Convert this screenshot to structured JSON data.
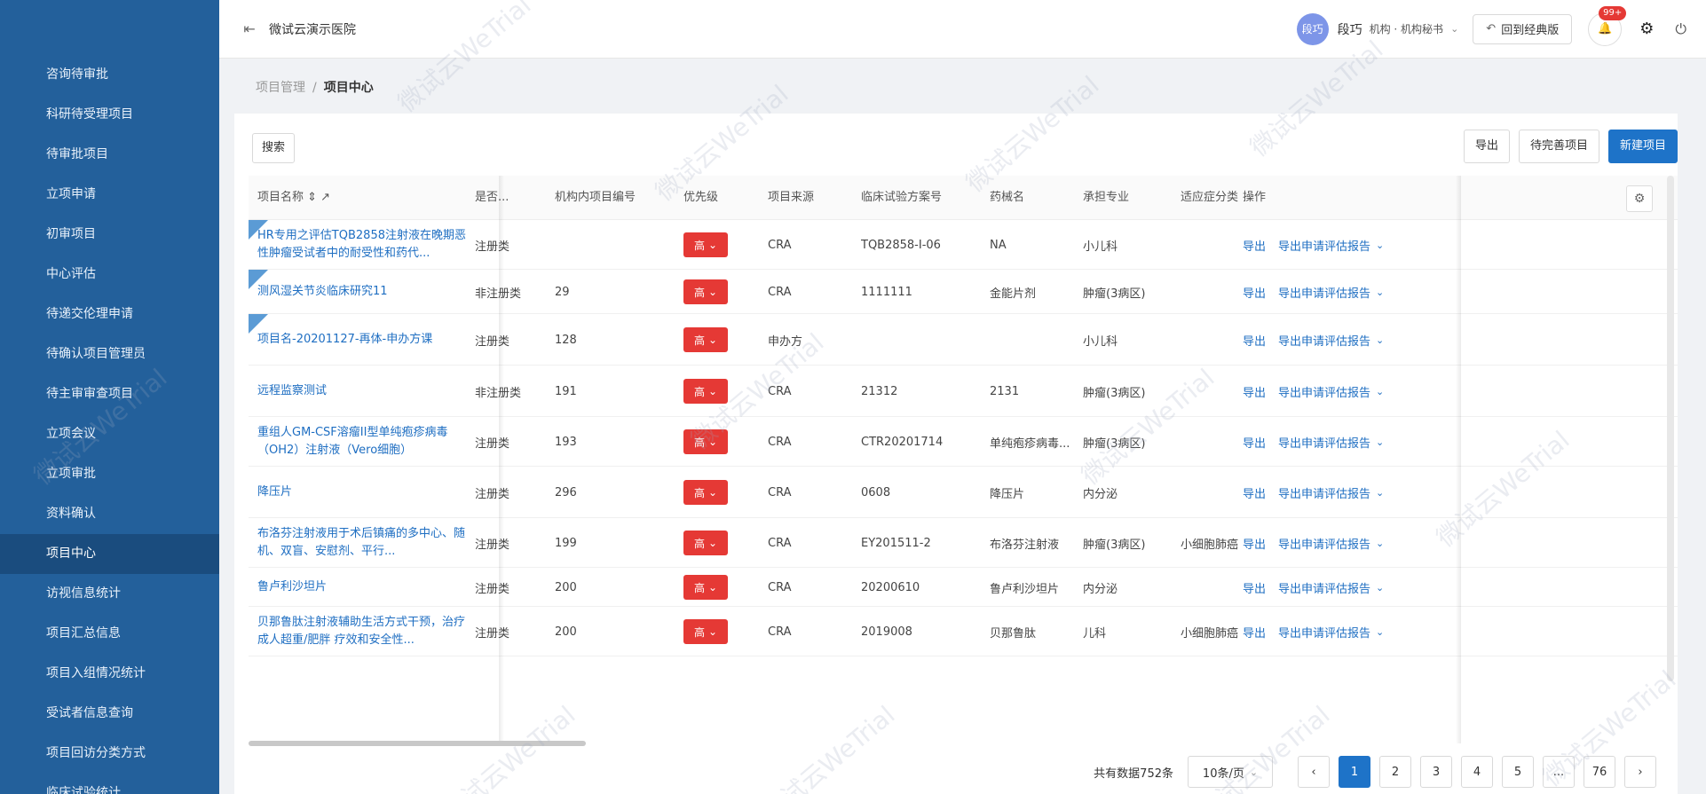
{
  "header": {
    "hospital_name": "微试云演示医院",
    "avatar_text": "段巧",
    "user_name": "段巧",
    "user_role": "机构 · 机构秘书",
    "classic_label": "回到经典版",
    "badge": "99+"
  },
  "sidebar": {
    "items": [
      {
        "label": "咨询待审批"
      },
      {
        "label": "科研待受理项目"
      },
      {
        "label": "待审批项目"
      },
      {
        "label": "立项申请"
      },
      {
        "label": "初审项目"
      },
      {
        "label": "中心评估"
      },
      {
        "label": "待递交伦理申请"
      },
      {
        "label": "待确认项目管理员"
      },
      {
        "label": "待主审审查项目"
      },
      {
        "label": "立项会议"
      },
      {
        "label": "立项审批"
      },
      {
        "label": "资料确认"
      },
      {
        "label": "项目中心"
      },
      {
        "label": "访视信息统计"
      },
      {
        "label": "项目汇总信息"
      },
      {
        "label": "项目入组情况统计"
      },
      {
        "label": "受试者信息查询"
      },
      {
        "label": "项目回访分类方式"
      },
      {
        "label": "临床试验统计"
      }
    ],
    "active_index": 12
  },
  "breadcrumb": {
    "parent": "项目管理",
    "separator": "/",
    "current": "项目中心"
  },
  "toolbar": {
    "search_label": "搜索",
    "export_label": "导出",
    "pending_label": "待完善项目",
    "new_label": "新建项目"
  },
  "table": {
    "columns": [
      "项目名称 ⇕ ↗",
      "是否...",
      "机构内项目编号",
      "优先级",
      "项目来源",
      "临床试验方案号",
      "药械名",
      "承担专业",
      "适应症分类",
      "操作"
    ],
    "rows": [
      {
        "name": "HR专用之评估TQB2858注射液在晚期恶性肿瘤受试者中的耐受性和药代...",
        "is": "注册类",
        "no": "",
        "prio": "高",
        "source": "CRA",
        "protocol": "TQB2858-I-06",
        "drug": "NA",
        "dept": "小儿科",
        "indication": "",
        "tagged": true
      },
      {
        "name": "测风湿关节炎临床研究11",
        "is": "非注册类",
        "no": "29",
        "prio": "高",
        "source": "CRA",
        "protocol": "1111111",
        "drug": "金能片剂",
        "dept": "肿瘤(3病区)",
        "indication": "",
        "tagged": true
      },
      {
        "name": "项目名-20201127-再体-申办方课",
        "is": "注册类",
        "no": "128",
        "prio": "高",
        "source": "申办方",
        "protocol": "",
        "drug": "",
        "dept": "小儿科",
        "indication": "",
        "tagged": true
      },
      {
        "name": "远程监察测试",
        "is": "非注册类",
        "no": "191",
        "prio": "高",
        "source": "CRA",
        "protocol": "21312",
        "drug": "2131",
        "dept": "肿瘤(3病区)",
        "indication": "",
        "tagged": false
      },
      {
        "name": "重组人GM-CSF溶瘤II型单纯疱疹病毒（OH2）注射液（Vero细胞）",
        "is": "注册类",
        "no": "193",
        "prio": "高",
        "source": "CRA",
        "protocol": "CTR20201714",
        "drug": "单纯疱疹病毒...",
        "dept": "肿瘤(3病区)",
        "indication": "",
        "tagged": false
      },
      {
        "name": "降压片",
        "is": "注册类",
        "no": "296",
        "prio": "高",
        "source": "CRA",
        "protocol": "0608",
        "drug": "降压片",
        "dept": "内分泌",
        "indication": "",
        "tagged": false
      },
      {
        "name": "布洛芬注射液用于术后镇痛的多中心、随机、双盲、安慰剂、平行...",
        "is": "注册类",
        "no": "199",
        "prio": "高",
        "source": "CRA",
        "protocol": "EY201511-2",
        "drug": "布洛芬注射液",
        "dept": "肿瘤(3病区)",
        "indication": "小细胞肺癌",
        "tagged": false
      },
      {
        "name": "鲁卢利沙坦片",
        "is": "注册类",
        "no": "200",
        "prio": "高",
        "source": "CRA",
        "protocol": "20200610",
        "drug": "鲁卢利沙坦片",
        "dept": "内分泌",
        "indication": "",
        "tagged": false
      },
      {
        "name": "贝那鲁肽注射液辅助生活方式干预，治疗成人超重/肥胖 疗效和安全性...",
        "is": "注册类",
        "no": "200",
        "prio": "高",
        "source": "CRA",
        "protocol": "2019008",
        "drug": "贝那鲁肽",
        "dept": "儿科",
        "indication": "小细胞肺癌",
        "tagged": false
      }
    ],
    "ops": {
      "export": "导出",
      "report": "导出申请评估报告"
    }
  },
  "pagination": {
    "total": "共有数据752条",
    "page_size": "10条/页",
    "pages": [
      "1",
      "2",
      "3",
      "4",
      "5",
      "...",
      "76"
    ],
    "active_page": "1"
  },
  "watermark": "微试云WeTrial"
}
